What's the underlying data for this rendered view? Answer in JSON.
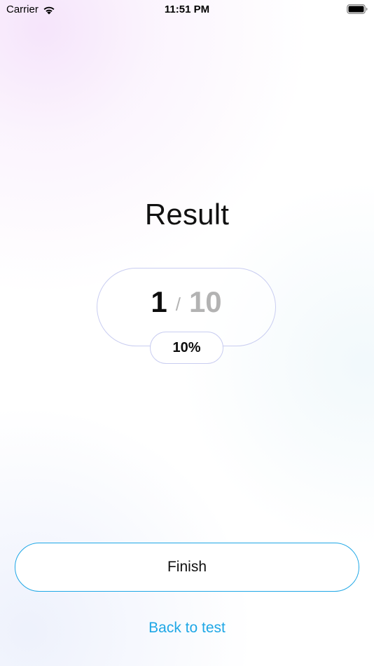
{
  "status_bar": {
    "carrier": "Carrier",
    "time": "11:51 PM",
    "wifi_icon": "wifi-icon",
    "battery_icon": "battery-full-icon"
  },
  "result": {
    "title": "Result",
    "correct": "1",
    "separator": "/",
    "total": "10",
    "percent": "10%",
    "progress_fraction": 0.1
  },
  "actions": {
    "finish_label": "Finish",
    "back_label": "Back to test"
  },
  "colors": {
    "accent": "#1ea7e6",
    "pill_border": "#c9cdf1",
    "muted_text": "#b3b3b3",
    "text": "#111111"
  }
}
